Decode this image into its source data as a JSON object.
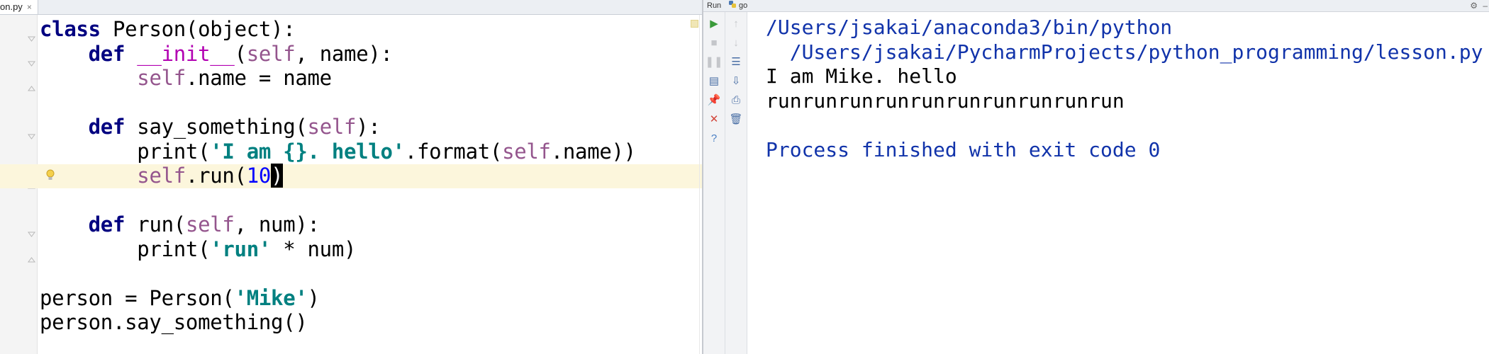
{
  "editor": {
    "tab": {
      "filename": "on.py",
      "close": "×"
    },
    "code_lines": [
      [
        {
          "t": "class",
          "c": "kw"
        },
        {
          "t": " Person(object):",
          "c": ""
        }
      ],
      [
        {
          "t": "    ",
          "c": ""
        },
        {
          "t": "def",
          "c": "kw"
        },
        {
          "t": " ",
          "c": ""
        },
        {
          "t": "__init__",
          "c": "magic"
        },
        {
          "t": "(",
          "c": ""
        },
        {
          "t": "self",
          "c": "self"
        },
        {
          "t": ", name):",
          "c": ""
        }
      ],
      [
        {
          "t": "        ",
          "c": ""
        },
        {
          "t": "self",
          "c": "self"
        },
        {
          "t": ".name = name",
          "c": ""
        }
      ],
      [
        {
          "t": "",
          "c": ""
        }
      ],
      [
        {
          "t": "    ",
          "c": ""
        },
        {
          "t": "def",
          "c": "kw"
        },
        {
          "t": " say_something(",
          "c": ""
        },
        {
          "t": "self",
          "c": "self"
        },
        {
          "t": "):",
          "c": ""
        }
      ],
      [
        {
          "t": "        print(",
          "c": ""
        },
        {
          "t": "'I am {}. hello'",
          "c": "str"
        },
        {
          "t": ".format(",
          "c": ""
        },
        {
          "t": "self",
          "c": "self"
        },
        {
          "t": ".name))",
          "c": ""
        }
      ],
      [
        {
          "t": "        ",
          "c": ""
        },
        {
          "t": "self",
          "c": "self"
        },
        {
          "t": ".run(",
          "c": ""
        },
        {
          "t": "10",
          "c": "num"
        },
        {
          "t": ")",
          "c": "cursor"
        }
      ],
      [
        {
          "t": "",
          "c": ""
        }
      ],
      [
        {
          "t": "    ",
          "c": ""
        },
        {
          "t": "def",
          "c": "kw"
        },
        {
          "t": " run(",
          "c": ""
        },
        {
          "t": "self",
          "c": "self"
        },
        {
          "t": ", num):",
          "c": ""
        }
      ],
      [
        {
          "t": "        print(",
          "c": ""
        },
        {
          "t": "'run'",
          "c": "str"
        },
        {
          "t": " * num)",
          "c": ""
        }
      ],
      [
        {
          "t": "",
          "c": ""
        }
      ],
      [
        {
          "t": "person = Person(",
          "c": ""
        },
        {
          "t": "'Mike'",
          "c": "str"
        },
        {
          "t": ")",
          "c": ""
        }
      ],
      [
        {
          "t": "person.say_something()",
          "c": ""
        }
      ]
    ],
    "caret_line": 7
  },
  "run_window": {
    "title": "Run",
    "config_name": "go",
    "toolbar_left": [
      {
        "icon": "run-icon",
        "glyph": "▶",
        "color": "#3a9a3a",
        "enabled": true
      },
      {
        "icon": "stop-icon",
        "glyph": "■",
        "color": "#c4c6ca",
        "enabled": false
      },
      {
        "icon": "pause-icon",
        "glyph": "❚❚",
        "color": "#c4c6ca",
        "enabled": false
      },
      {
        "icon": "dump-threads-icon",
        "glyph": "▤",
        "color": "#4a6fa5",
        "enabled": true
      },
      {
        "icon": "pin-icon",
        "glyph": "📌",
        "color": "#4a6fa5",
        "enabled": true
      },
      {
        "icon": "close-icon",
        "glyph": "✕",
        "color": "#d2453a",
        "enabled": true
      },
      {
        "icon": "help-icon",
        "glyph": "?",
        "color": "#4a7fc4",
        "enabled": true
      }
    ],
    "toolbar_right": [
      {
        "icon": "up-arrow-icon",
        "glyph": "↑",
        "color": "#c4c6ca",
        "enabled": false
      },
      {
        "icon": "down-arrow-icon",
        "glyph": "↓",
        "color": "#c4c6ca",
        "enabled": false
      },
      {
        "icon": "soft-wrap-icon",
        "glyph": "☰",
        "color": "#4a6fa5",
        "enabled": true
      },
      {
        "icon": "scroll-to-end-icon",
        "glyph": "⇩",
        "color": "#4a6fa5",
        "enabled": true
      },
      {
        "icon": "print-icon",
        "glyph": "⎙",
        "color": "#4a6fa5",
        "enabled": true
      },
      {
        "icon": "trash-icon",
        "glyph": "🗑",
        "color": "#4a6fa5",
        "enabled": true
      }
    ],
    "console_lines": [
      {
        "text": "/Users/jsakai/anaconda3/bin/python",
        "kind": "path"
      },
      {
        "text": "  /Users/jsakai/PycharmProjects/python_programming/lesson.py",
        "kind": "path"
      },
      {
        "text": "I am Mike. hello",
        "kind": "out"
      },
      {
        "text": "runrunrunrunrunrunrunrunrunrun",
        "kind": "out"
      },
      {
        "text": "",
        "kind": "out"
      },
      {
        "text": "Process finished with exit code 0",
        "kind": "exit"
      }
    ]
  },
  "colors": {
    "keyword": "#000080",
    "string": "#008080",
    "self": "#94558d",
    "number": "#0000ff",
    "console_path": "#1133aa",
    "caret_line": "#fcf6dc"
  }
}
